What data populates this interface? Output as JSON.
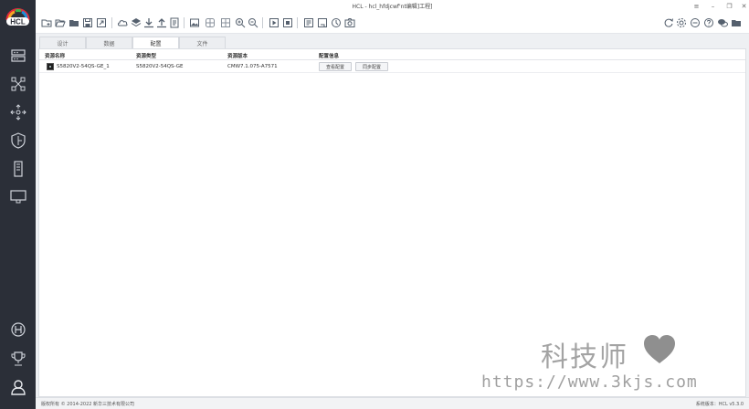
{
  "app": {
    "logo_text": "HCL",
    "title": "HCL - hcl_hfdjcwf'nt编辑]工程]"
  },
  "sidebar": {
    "items": [
      {
        "icon": "device-list-icon"
      },
      {
        "icon": "topology-icon"
      },
      {
        "icon": "network-expand-icon"
      },
      {
        "icon": "shield-icon"
      },
      {
        "icon": "server-icon"
      },
      {
        "icon": "monitor-icon"
      }
    ],
    "bottom": [
      {
        "icon": "h3c-icon"
      },
      {
        "icon": "trophy-icon"
      },
      {
        "icon": "user-icon"
      }
    ]
  },
  "tabs": [
    {
      "label": "设计",
      "active": false
    },
    {
      "label": "数据",
      "active": false
    },
    {
      "label": "配置",
      "active": true
    },
    {
      "label": "文件",
      "active": false
    }
  ],
  "table": {
    "columns": [
      "资源名称",
      "资源类型",
      "资源版本",
      "配置信息"
    ],
    "rows": [
      {
        "name": "S5820V2-54QS-GE_1",
        "type": "S5820V2-54QS-GE",
        "version": "CMW7.1.075-A7571",
        "buttons": [
          "查看配置",
          "同步配置"
        ]
      }
    ]
  },
  "status": {
    "copyright": "版权所有 © 2014-2022 新华三技术有限公司",
    "version": "系统版本：HCL v5.3.0"
  },
  "watermark": {
    "text": "科技师",
    "url": "https://www.3kjs.com"
  },
  "colors": {
    "sidebar_bg": "#2b2f38",
    "accent": "#1e8fd8"
  }
}
